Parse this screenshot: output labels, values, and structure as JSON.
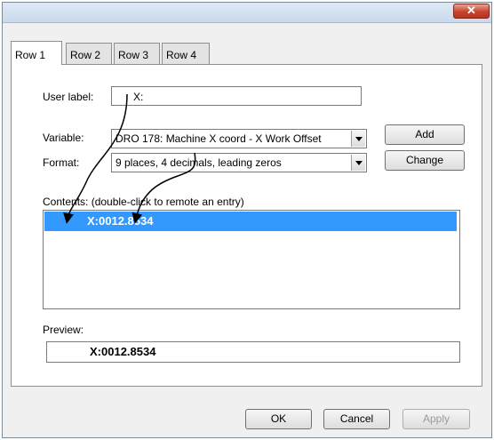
{
  "window": {
    "close_glyph": "✕"
  },
  "tabs": [
    {
      "label": "Row 1",
      "active": true
    },
    {
      "label": "Row 2",
      "active": false
    },
    {
      "label": "Row 3",
      "active": false
    },
    {
      "label": "Row 4",
      "active": false
    }
  ],
  "form": {
    "user_label": {
      "label": "User label:",
      "value": "X:"
    },
    "variable": {
      "label": "Variable:",
      "value": "DRO 178: Machine X coord - X Work Offset"
    },
    "format": {
      "label": "Format:",
      "value": "9 places, 4 decimals, leading zeros"
    },
    "add_label": "Add",
    "change_label": "Change"
  },
  "contents": {
    "label": "Contents: (double-click to remote an entry)",
    "items": [
      {
        "text": "X:0012.8534",
        "selected": true
      }
    ]
  },
  "preview": {
    "label": "Preview:",
    "value": "X:0012.8534"
  },
  "footer": {
    "ok_label": "OK",
    "cancel_label": "Cancel",
    "apply_label": "Apply"
  },
  "colors": {
    "selection": "#3399ff",
    "close": "#c7432c"
  }
}
